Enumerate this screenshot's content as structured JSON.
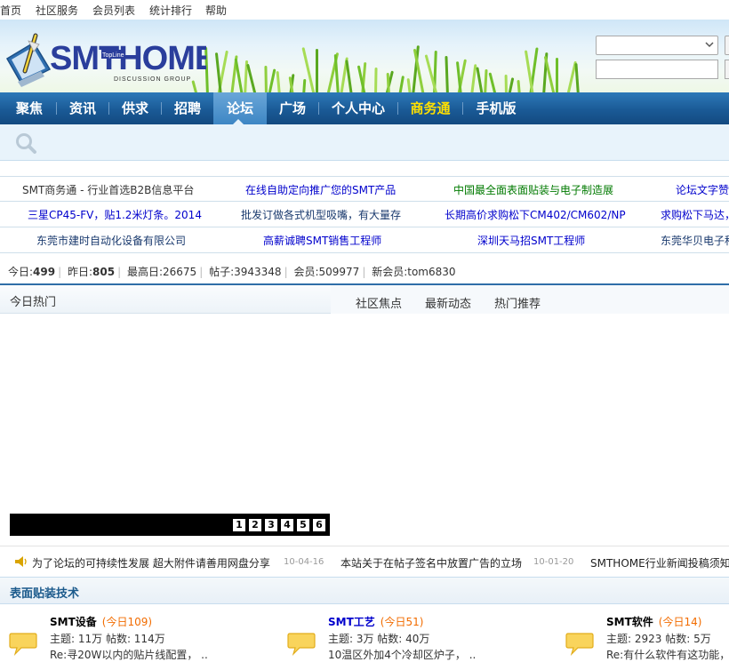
{
  "topnav": [
    "首页",
    "社区服务",
    "会员列表",
    "统计排行",
    "帮助"
  ],
  "logo": {
    "text": "SMTHOME",
    "sub": "DISCUSSION GROUP"
  },
  "nav": [
    {
      "label": "聚焦"
    },
    {
      "label": "资讯"
    },
    {
      "label": "供求"
    },
    {
      "label": "招聘"
    },
    {
      "label": "论坛",
      "active": true
    },
    {
      "label": "广场"
    },
    {
      "label": "个人中心"
    },
    {
      "label": "商务通",
      "highlight": true
    },
    {
      "label": "手机版"
    }
  ],
  "ads": [
    [
      {
        "text": "SMT商务通 - 行业首选B2B信息平台",
        "color": "#333333"
      },
      {
        "text": "在线自助定向推广您的SMT产品",
        "color": "#0000cc"
      },
      {
        "text": "中国最全面表面贴装与电子制造展",
        "color": "#007a00"
      },
      {
        "text": "论坛文字赞",
        "color": "#0000cc"
      }
    ],
    [
      {
        "text": "三星CP45-FV，贴1.2米灯条。2014",
        "color": "#0000cc"
      },
      {
        "text": "批发订做各式机型吸嘴，有大量存",
        "color": "#1a3a6e"
      },
      {
        "text": "长期高价求购松下CM402/CM602/NP",
        "color": "#0000cc"
      },
      {
        "text": "求购松下马达，",
        "color": "#0000cc"
      }
    ],
    [
      {
        "text": "东莞市建时自动化设备有限公司",
        "color": "#1a3a6e"
      },
      {
        "text": "高薪诚聘SMT销售工程师",
        "color": "#0000cc"
      },
      {
        "text": "深圳天马招SMT工程师",
        "color": "#0000cc"
      },
      {
        "text": "东莞华贝电子科",
        "color": "#1a3a6e"
      }
    ]
  ],
  "stats": {
    "today_label": "今日:",
    "today": "499",
    "yesterday_label": "昨日:",
    "yesterday": "805",
    "max_label": "最高日:",
    "max": "26675",
    "posts_label": "帖子:",
    "posts": "3943348",
    "members_label": "会员:",
    "members": "509977",
    "newmember_label": "新会员:",
    "newmember": "tom6830"
  },
  "hot": {
    "title": "今日热门",
    "tabs": [
      "社区焦点",
      "最新动态",
      "热门推荐"
    ]
  },
  "slideshow": {
    "pages": [
      "1",
      "2",
      "3",
      "4",
      "5",
      "6"
    ]
  },
  "announcements": [
    {
      "title": "为了论坛的可持续性发展 超大附件请善用网盘分享",
      "date": "10-04-16"
    },
    {
      "title": "本站关于在帖子签名中放置广告的立场",
      "date": "10-01-20"
    },
    {
      "title": "SMTHOME行业新闻投稿须知",
      "date": ""
    }
  ],
  "category": {
    "title": "表面贴装技术"
  },
  "forums": [
    {
      "name": "SMT设备",
      "name_color": "#000000",
      "today": "(今日109)",
      "stats": "主题: 11万   帖数: 114万",
      "last": "Re:寻20W以内的贴片线配置，   .."
    },
    {
      "name": "SMT工艺",
      "name_color": "#0000cc",
      "today": "(今日51)",
      "stats": "主题: 3万   帖数: 40万",
      "last": "10温区外加4个冷却区炉子，   .."
    },
    {
      "name": "SMT软件",
      "name_color": "#000000",
      "today": "(今日14)",
      "stats": "主题: 2923   帖数: 5万",
      "last": "Re:有什么软件有这功能，"
    }
  ],
  "colors": {
    "nav": "#1a5a96",
    "accent": "#2f6ea8",
    "gold": "#ffe000",
    "today": "#f26c00"
  }
}
